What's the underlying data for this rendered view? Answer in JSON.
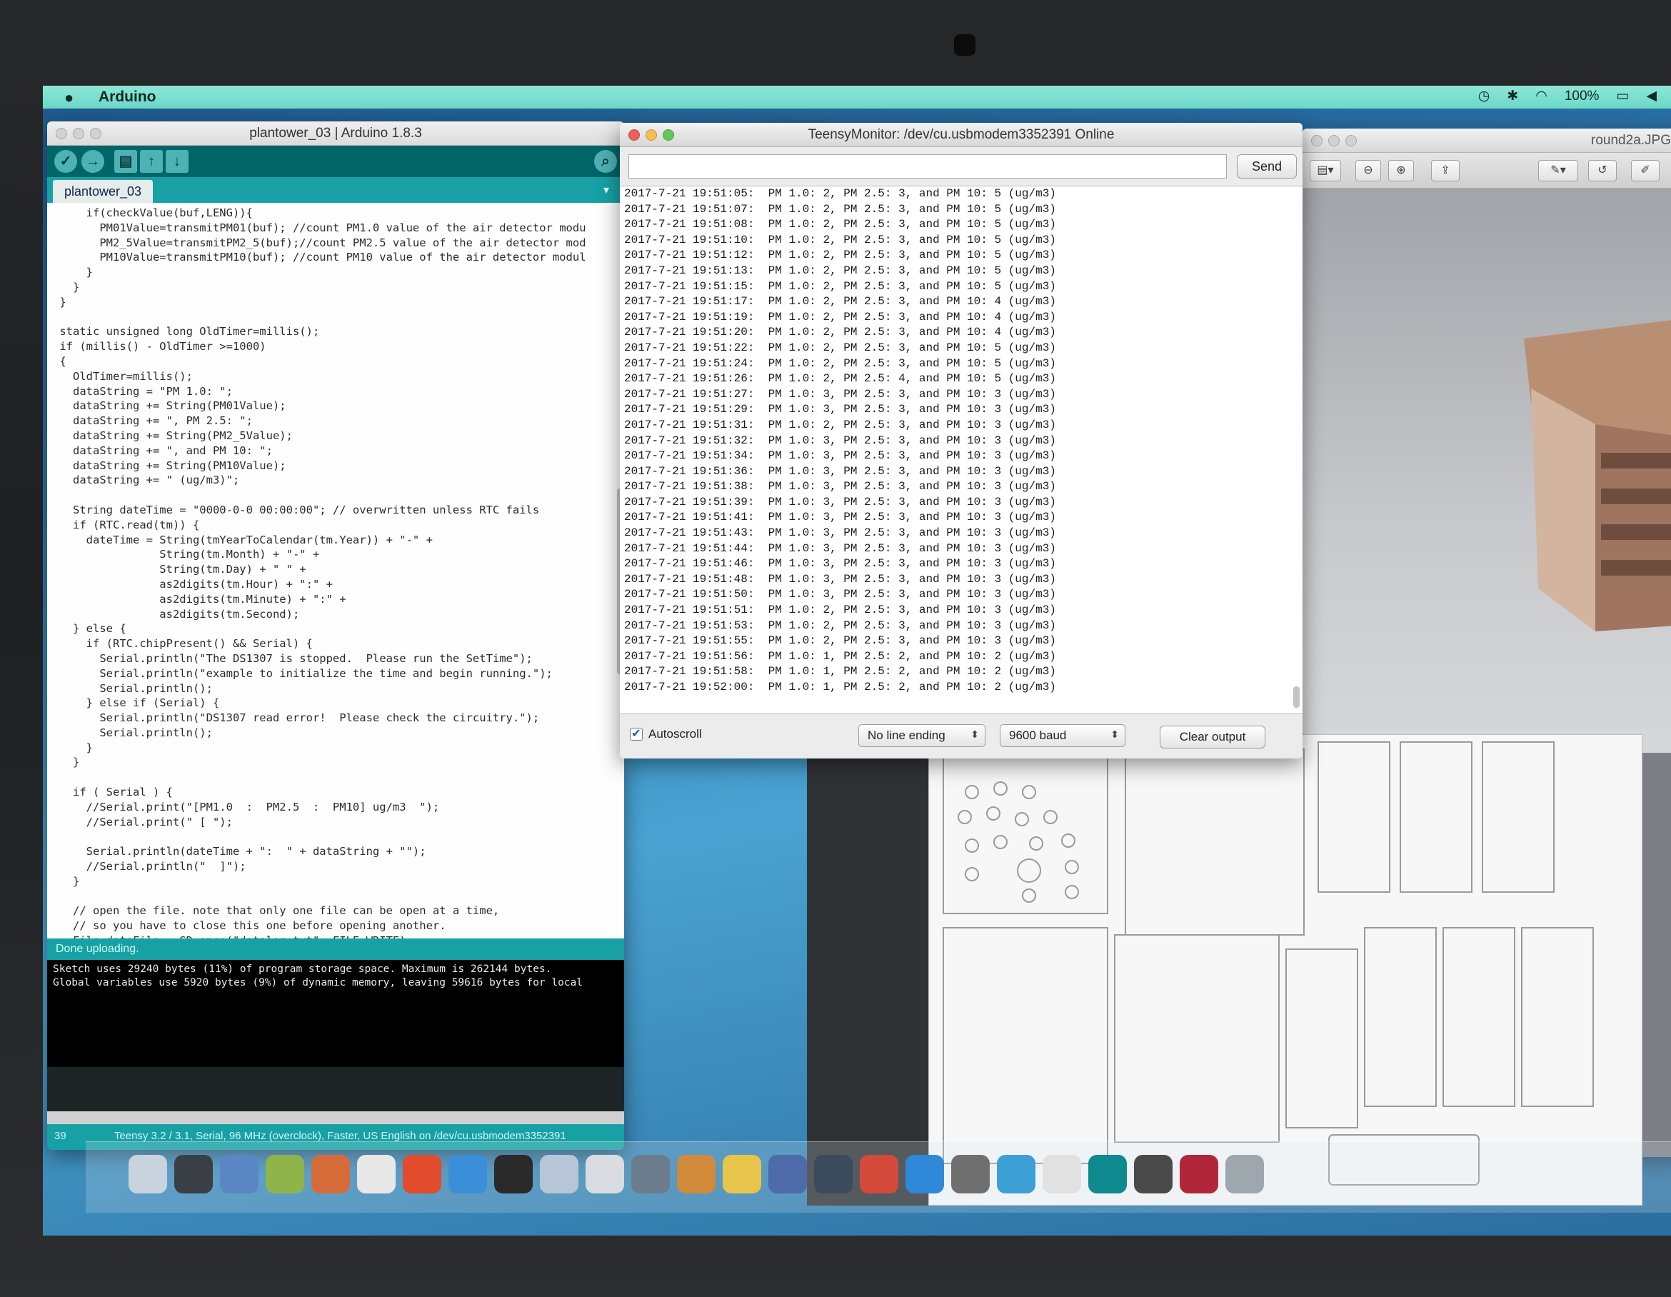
{
  "menubar": {
    "app_name": "Arduino",
    "battery": "100%"
  },
  "arduino": {
    "title": "plantower_03 | Arduino 1.8.3",
    "tab": "plantower_03",
    "code_lines": [
      "     if(checkValue(buf,LENG)){",
      "       PM01Value=transmitPM01(buf); //count PM1.0 value of the air detector modu",
      "       PM2_5Value=transmitPM2_5(buf);//count PM2.5 value of the air detector mod",
      "       PM10Value=transmitPM10(buf); //count PM10 value of the air detector modul",
      "     }",
      "   }",
      " }",
      "",
      " static unsigned long OldTimer=millis();",
      " if (millis() - OldTimer >=1000)",
      " {",
      "   OldTimer=millis();",
      "   dataString = \"PM 1.0: \";",
      "   dataString += String(PM01Value);",
      "   dataString += \", PM 2.5: \";",
      "   dataString += String(PM2_5Value);",
      "   dataString += \", and PM 10: \";",
      "   dataString += String(PM10Value);",
      "   dataString += \" (ug/m3)\";",
      "",
      "   String dateTime = \"0000-0-0 00:00:00\"; // overwritten unless RTC fails",
      "   if (RTC.read(tm)) {",
      "     dateTime = String(tmYearToCalendar(tm.Year)) + \"-\" +",
      "                String(tm.Month) + \"-\" +",
      "                String(tm.Day) + \" \" +",
      "                as2digits(tm.Hour) + \":\" +",
      "                as2digits(tm.Minute) + \":\" +",
      "                as2digits(tm.Second);",
      "   } else {",
      "     if (RTC.chipPresent() && Serial) {",
      "       Serial.println(\"The DS1307 is stopped.  Please run the SetTime\");",
      "       Serial.println(\"example to initialize the time and begin running.\");",
      "       Serial.println();",
      "     } else if (Serial) {",
      "       Serial.println(\"DS1307 read error!  Please check the circuitry.\");",
      "       Serial.println();",
      "     }",
      "   }",
      "",
      "   if ( Serial ) {",
      "     //Serial.print(\"[PM1.0  :  PM2.5  :  PM10] ug/m3  \");",
      "     //Serial.print(\" [ \");",
      "",
      "     Serial.println(dateTime + \":  \" + dataString + \"\");",
      "     //Serial.println(\"  ]\");",
      "   }",
      "",
      "   // open the file. note that only one file can be open at a time,",
      "   // so you have to close this one before opening another.",
      "   File dataFile = SD.open(\"datalog.txt\", FILE_WRITE);"
    ],
    "status": "Done uploading.",
    "console_lines": [
      "Sketch uses 29240 bytes (11%) of program storage space. Maximum is 262144 bytes.",
      "Global variables use 5920 bytes (9%) of dynamic memory, leaving 59616 bytes for local"
    ],
    "footer_line": "39",
    "footer_board": "Teensy 3.2 / 3.1, Serial, 96 MHz (overclock), Faster, US English on /dev/cu.usbmodem3352391"
  },
  "teensy": {
    "title": "TeensyMonitor: /dev/cu.usbmodem3352391 Online",
    "input_value": "",
    "send_label": "Send",
    "rows": [
      "2017-7-21 19:51:05:  PM 1.0: 2, PM 2.5: 3, and PM 10: 5 (ug/m3)",
      "2017-7-21 19:51:07:  PM 1.0: 2, PM 2.5: 3, and PM 10: 5 (ug/m3)",
      "2017-7-21 19:51:08:  PM 1.0: 2, PM 2.5: 3, and PM 10: 5 (ug/m3)",
      "2017-7-21 19:51:10:  PM 1.0: 2, PM 2.5: 3, and PM 10: 5 (ug/m3)",
      "2017-7-21 19:51:12:  PM 1.0: 2, PM 2.5: 3, and PM 10: 5 (ug/m3)",
      "2017-7-21 19:51:13:  PM 1.0: 2, PM 2.5: 3, and PM 10: 5 (ug/m3)",
      "2017-7-21 19:51:15:  PM 1.0: 2, PM 2.5: 3, and PM 10: 5 (ug/m3)",
      "2017-7-21 19:51:17:  PM 1.0: 2, PM 2.5: 3, and PM 10: 4 (ug/m3)",
      "2017-7-21 19:51:19:  PM 1.0: 2, PM 2.5: 3, and PM 10: 4 (ug/m3)",
      "2017-7-21 19:51:20:  PM 1.0: 2, PM 2.5: 3, and PM 10: 4 (ug/m3)",
      "2017-7-21 19:51:22:  PM 1.0: 2, PM 2.5: 3, and PM 10: 5 (ug/m3)",
      "2017-7-21 19:51:24:  PM 1.0: 2, PM 2.5: 3, and PM 10: 5 (ug/m3)",
      "2017-7-21 19:51:26:  PM 1.0: 2, PM 2.5: 4, and PM 10: 5 (ug/m3)",
      "2017-7-21 19:51:27:  PM 1.0: 3, PM 2.5: 3, and PM 10: 3 (ug/m3)",
      "2017-7-21 19:51:29:  PM 1.0: 3, PM 2.5: 3, and PM 10: 3 (ug/m3)",
      "2017-7-21 19:51:31:  PM 1.0: 2, PM 2.5: 3, and PM 10: 3 (ug/m3)",
      "2017-7-21 19:51:32:  PM 1.0: 3, PM 2.5: 3, and PM 10: 3 (ug/m3)",
      "2017-7-21 19:51:34:  PM 1.0: 3, PM 2.5: 3, and PM 10: 3 (ug/m3)",
      "2017-7-21 19:51:36:  PM 1.0: 3, PM 2.5: 3, and PM 10: 3 (ug/m3)",
      "2017-7-21 19:51:38:  PM 1.0: 3, PM 2.5: 3, and PM 10: 3 (ug/m3)",
      "2017-7-21 19:51:39:  PM 1.0: 3, PM 2.5: 3, and PM 10: 3 (ug/m3)",
      "2017-7-21 19:51:41:  PM 1.0: 3, PM 2.5: 3, and PM 10: 3 (ug/m3)",
      "2017-7-21 19:51:43:  PM 1.0: 3, PM 2.5: 3, and PM 10: 3 (ug/m3)",
      "2017-7-21 19:51:44:  PM 1.0: 3, PM 2.5: 3, and PM 10: 3 (ug/m3)",
      "2017-7-21 19:51:46:  PM 1.0: 3, PM 2.5: 3, and PM 10: 3 (ug/m3)",
      "2017-7-21 19:51:48:  PM 1.0: 3, PM 2.5: 3, and PM 10: 3 (ug/m3)",
      "2017-7-21 19:51:50:  PM 1.0: 3, PM 2.5: 3, and PM 10: 3 (ug/m3)",
      "2017-7-21 19:51:51:  PM 1.0: 2, PM 2.5: 3, and PM 10: 3 (ug/m3)",
      "2017-7-21 19:51:53:  PM 1.0: 2, PM 2.5: 3, and PM 10: 3 (ug/m3)",
      "2017-7-21 19:51:55:  PM 1.0: 2, PM 2.5: 3, and PM 10: 3 (ug/m3)",
      "2017-7-21 19:51:56:  PM 1.0: 1, PM 2.5: 2, and PM 10: 2 (ug/m3)",
      "2017-7-21 19:51:58:  PM 1.0: 1, PM 2.5: 2, and PM 10: 2 (ug/m3)",
      "2017-7-21 19:52:00:  PM 1.0: 1, PM 2.5: 2, and PM 10: 2 (ug/m3)"
    ],
    "autoscroll_label": "Autoscroll",
    "line_ending": "No line ending",
    "baud": "9600 baud",
    "clear_label": "Clear output"
  },
  "preview": {
    "title": "round2a.JPG"
  },
  "colors": {
    "arduino_teal": "#17a1a5",
    "arduino_dark_teal": "#006468",
    "menubar": "#7ee0d0"
  }
}
